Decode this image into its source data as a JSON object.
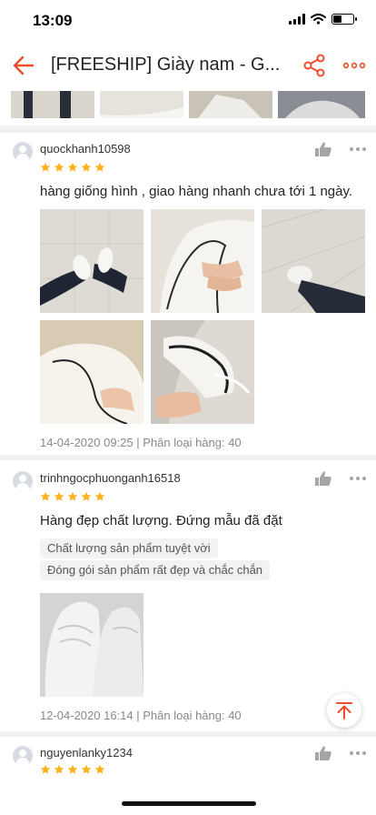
{
  "status_bar": {
    "time": "13:09"
  },
  "header": {
    "title": "[FREESHIP] Giày nam - G..."
  },
  "reviews": [
    {
      "username": "quockhanh10598",
      "rating": 5,
      "comment": "hàng giống hình , giao hàng nhanh chưa tới 1 ngày.",
      "photo_count": 5,
      "meta": "14-04-2020 09:25 | Phân loại hàng: 40"
    },
    {
      "username": "trinhngocphuonganh16518",
      "rating": 5,
      "comment": "Hàng đẹp chất lượng. Đứng mẫu đã đặt",
      "tags": [
        "Chất lượng sản phẩm tuyệt vời",
        "Đóng gói sản phẩm rất đẹp và chắc chắn"
      ],
      "photo_count": 1,
      "meta": "12-04-2020 16:14 | Phân loại hàng: 40"
    },
    {
      "username": "nguyenlanky1234",
      "rating": 5
    }
  ],
  "colors": {
    "brand": "#ee4d2d",
    "star": "#ffb21d",
    "meta_text": "#888888"
  },
  "icons": [
    "back-arrow-icon",
    "share-icon",
    "more-icon",
    "thumbs-up-icon",
    "dots-icon",
    "star-icon",
    "scroll-to-top-icon"
  ]
}
